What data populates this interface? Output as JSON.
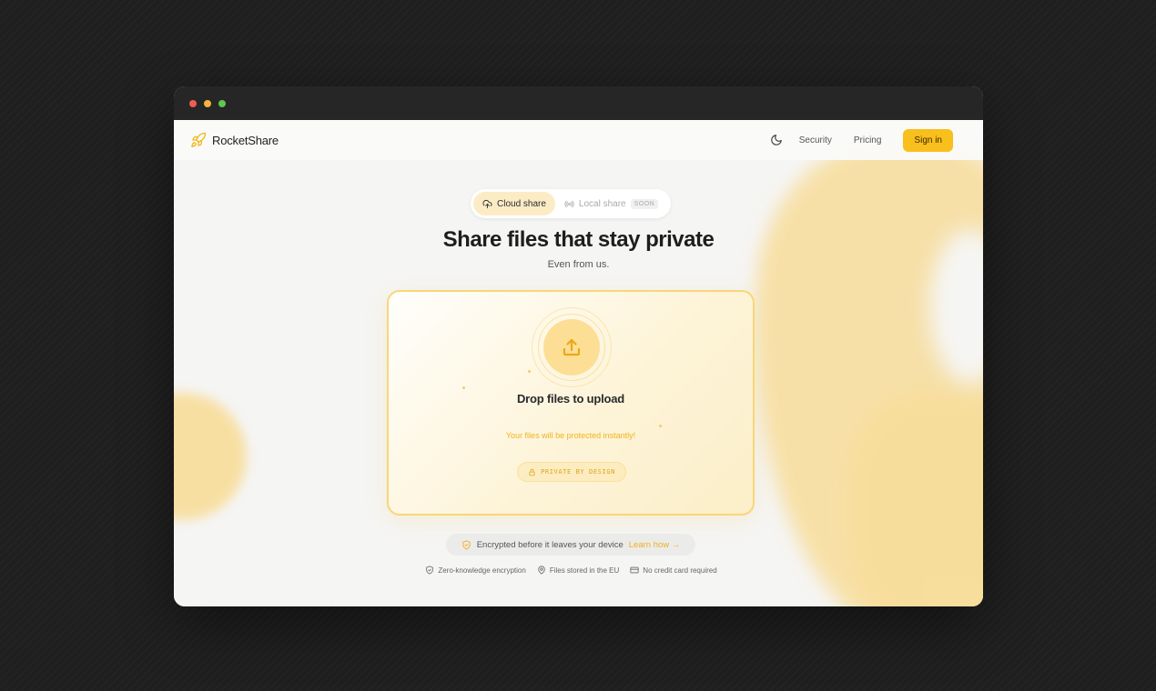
{
  "window": {
    "traffic_lights": [
      "#ee5d50",
      "#f4b53f",
      "#5fc74f"
    ]
  },
  "brand": {
    "name": "RocketShare",
    "logo_icon": "rocket-icon",
    "accent": "#f9bf1c"
  },
  "nav": {
    "theme_icon": "moon-icon",
    "links": [
      "Security",
      "Pricing"
    ],
    "signin_label": "Sign in"
  },
  "share_toggle": {
    "active": {
      "label": "Cloud share",
      "icon": "cloud-upload-icon"
    },
    "inactive": {
      "label": "Local share",
      "icon": "broadcast-icon",
      "badge": "SOON"
    }
  },
  "hero": {
    "title": "Share files that stay private",
    "subtitle": "Even from us."
  },
  "dropzone": {
    "icon": "upload-icon",
    "title": "Drop files to upload",
    "subtitle": "Your files will be protected instantly!",
    "badge_label": "PRIVATE BY DESIGN",
    "badge_icon": "lock-icon"
  },
  "encryption_note": {
    "icon": "shield-icon",
    "text": "Encrypted before it leaves your device",
    "link": "Learn how →"
  },
  "features": [
    {
      "icon": "shield-check-icon",
      "label": "Zero-knowledge encryption"
    },
    {
      "icon": "location-pin-icon",
      "label": "Files stored in the EU"
    },
    {
      "icon": "credit-card-icon",
      "label": "No credit card required"
    }
  ]
}
